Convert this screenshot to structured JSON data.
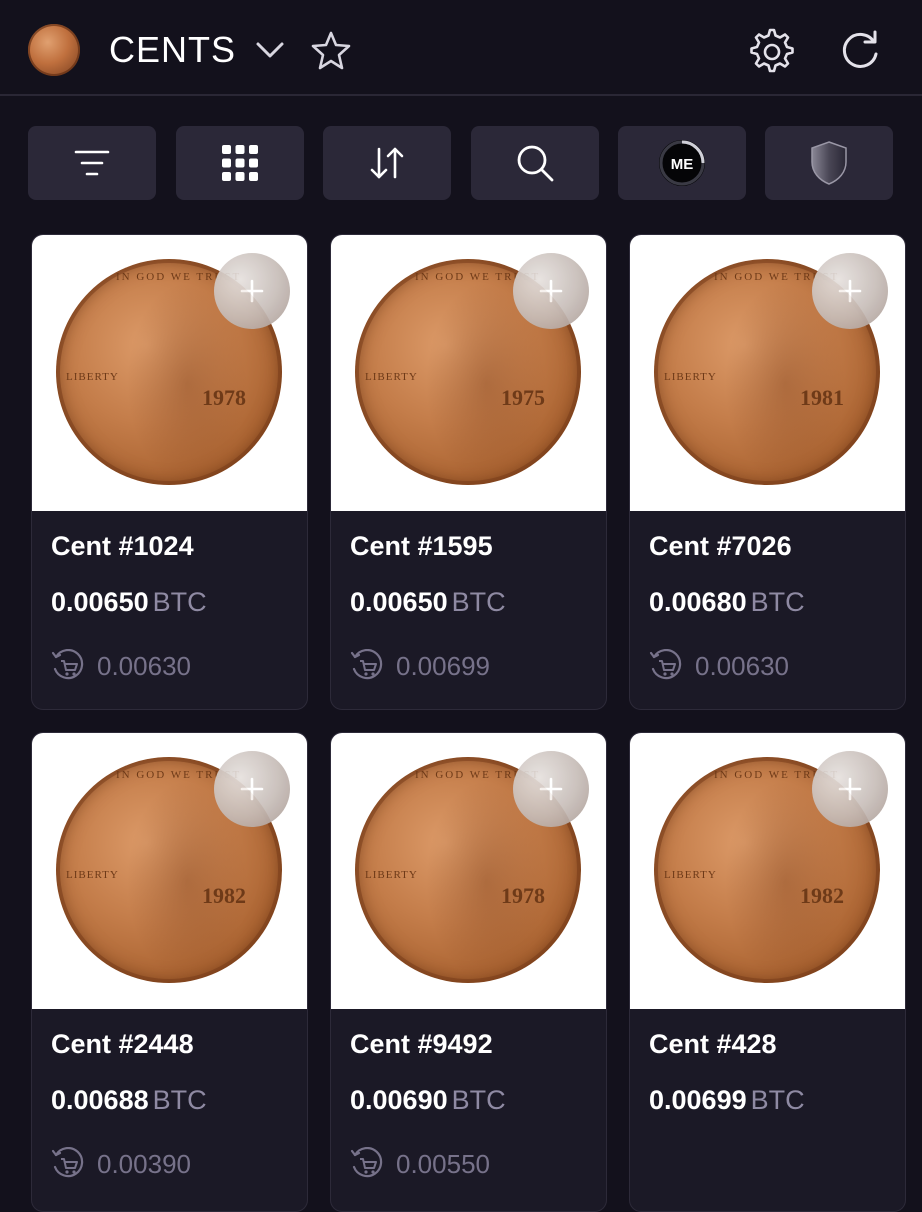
{
  "header": {
    "title": "CENTS"
  },
  "toolbar": {
    "buttons": [
      "filter-icon",
      "grid-icon",
      "sort-icon",
      "search-icon",
      "magic-eden-icon",
      "shield-icon"
    ],
    "brand_badge_text": "ME"
  },
  "colors": {
    "background": "#13111c",
    "card": "#1b1926",
    "toolbar_button": "#2b2838",
    "muted_text": "#77728a",
    "unit_text": "#8f8aa3"
  },
  "cards": [
    {
      "name": "Cent #1024",
      "price": "0.00650",
      "unit": "BTC",
      "last_sale": "0.00630",
      "coin_year": "1978"
    },
    {
      "name": "Cent #1595",
      "price": "0.00650",
      "unit": "BTC",
      "last_sale": "0.00699",
      "coin_year": "1975"
    },
    {
      "name": "Cent #7026",
      "price": "0.00680",
      "unit": "BTC",
      "last_sale": "0.00630",
      "coin_year": "1981"
    },
    {
      "name": "Cent #2448",
      "price": "0.00688",
      "unit": "BTC",
      "last_sale": "0.00390",
      "coin_year": "1982"
    },
    {
      "name": "Cent #9492",
      "price": "0.00690",
      "unit": "BTC",
      "last_sale": "0.00550",
      "coin_year": "1978"
    },
    {
      "name": "Cent #428",
      "price": "0.00699",
      "unit": "BTC",
      "last_sale": "",
      "coin_year": "1982"
    }
  ],
  "coin_text": {
    "liberty": "LIBERTY",
    "motto": "IN GOD WE TRUST"
  }
}
